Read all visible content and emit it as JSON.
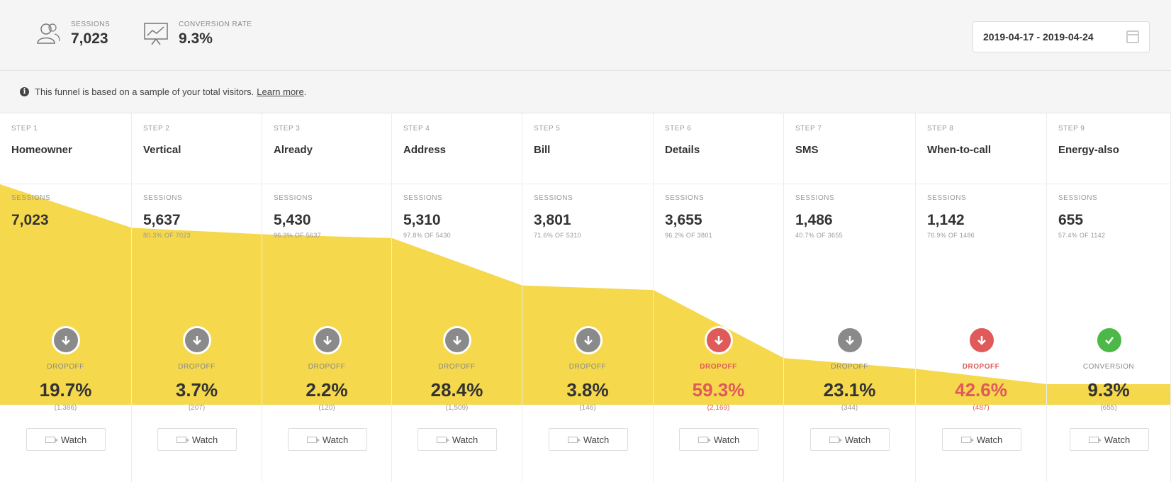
{
  "header": {
    "sessions": {
      "label": "SESSIONS",
      "value": "7,023",
      "icon": "users-icon"
    },
    "conversion": {
      "label": "CONVERSION RATE",
      "value": "9.3%",
      "icon": "presentation-chart-icon"
    },
    "date_range": "2019-04-17 - 2019-04-24"
  },
  "info": {
    "text": "This funnel is based on a sample of your total visitors.",
    "link": "Learn more",
    "suffix": "."
  },
  "sessions_label": "SESSIONS",
  "watch_label": "Watch",
  "colors": {
    "funnel": "#f5d84c",
    "drop_red": "#e05a5a",
    "marker_gray": "#8a8a8a",
    "conversion_green": "#4cb848"
  },
  "steps": [
    {
      "num": "STEP 1",
      "name": "Homeowner",
      "sessions": "7,023",
      "pct": "",
      "drop_label": "DROPOFF",
      "drop_value": "19.7%",
      "drop_count": "(1,386)",
      "status": "gray"
    },
    {
      "num": "STEP 2",
      "name": "Vertical",
      "sessions": "5,637",
      "pct": "80.3% OF 7023",
      "drop_label": "DROPOFF",
      "drop_value": "3.7%",
      "drop_count": "(207)",
      "status": "gray"
    },
    {
      "num": "STEP 3",
      "name": "Already",
      "sessions": "5,430",
      "pct": "96.3% OF 5637",
      "drop_label": "DROPOFF",
      "drop_value": "2.2%",
      "drop_count": "(120)",
      "status": "gray"
    },
    {
      "num": "STEP 4",
      "name": "Address",
      "sessions": "5,310",
      "pct": "97.8% OF 5430",
      "drop_label": "DROPOFF",
      "drop_value": "28.4%",
      "drop_count": "(1,509)",
      "status": "gray"
    },
    {
      "num": "STEP 5",
      "name": "Bill",
      "sessions": "3,801",
      "pct": "71.6% OF 5310",
      "drop_label": "DROPOFF",
      "drop_value": "3.8%",
      "drop_count": "(146)",
      "status": "gray"
    },
    {
      "num": "STEP 6",
      "name": "Details",
      "sessions": "3,655",
      "pct": "96.2% OF 3801",
      "drop_label": "DROPOFF",
      "drop_value": "59.3%",
      "drop_count": "(2,169)",
      "status": "red"
    },
    {
      "num": "STEP 7",
      "name": "SMS",
      "sessions": "1,486",
      "pct": "40.7% OF 3655",
      "drop_label": "DROPOFF",
      "drop_value": "23.1%",
      "drop_count": "(344)",
      "status": "gray"
    },
    {
      "num": "STEP 8",
      "name": "When-to-call",
      "sessions": "1,142",
      "pct": "76.9% OF 1486",
      "drop_label": "DROPOFF",
      "drop_value": "42.6%",
      "drop_count": "(487)",
      "status": "red"
    },
    {
      "num": "STEP 9",
      "name": "Energy-also",
      "sessions": "655",
      "pct": "57.4% OF 1142",
      "drop_label": "CONVERSION",
      "drop_value": "9.3%",
      "drop_count": "(655)",
      "status": "green"
    }
  ],
  "funnel_values": [
    7023,
    5637,
    5430,
    5310,
    3801,
    3655,
    1486,
    1142,
    655
  ]
}
